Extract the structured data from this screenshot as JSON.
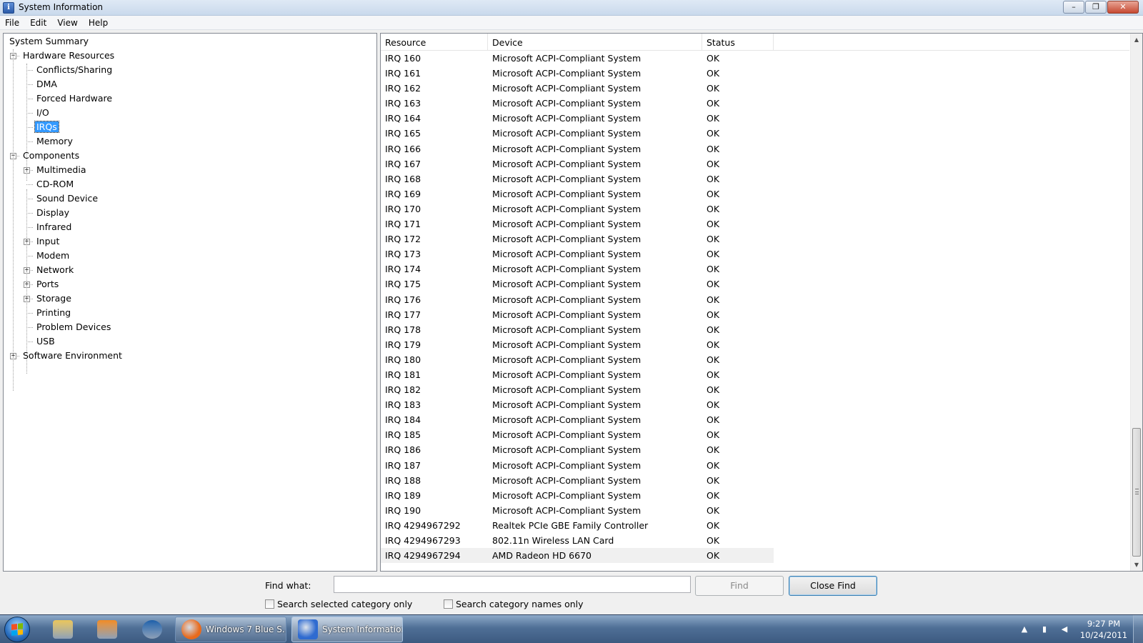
{
  "window": {
    "title": "System Information",
    "controls": {
      "minimize": "–",
      "maximize": "❐",
      "close": "✕"
    }
  },
  "menu": [
    "File",
    "Edit",
    "View",
    "Help"
  ],
  "tree": {
    "items": [
      {
        "label": "System Summary",
        "level": 0,
        "expander": "",
        "selected": false
      },
      {
        "label": "Hardware Resources",
        "level": 1,
        "expander": "−",
        "selected": false
      },
      {
        "label": "Conflicts/Sharing",
        "level": 2,
        "expander": "",
        "selected": false
      },
      {
        "label": "DMA",
        "level": 2,
        "expander": "",
        "selected": false
      },
      {
        "label": "Forced Hardware",
        "level": 2,
        "expander": "",
        "selected": false
      },
      {
        "label": "I/O",
        "level": 2,
        "expander": "",
        "selected": false
      },
      {
        "label": "IRQs",
        "level": 2,
        "expander": "",
        "selected": true
      },
      {
        "label": "Memory",
        "level": 2,
        "expander": "",
        "selected": false
      },
      {
        "label": "Components",
        "level": 1,
        "expander": "−",
        "selected": false
      },
      {
        "label": "Multimedia",
        "level": 2,
        "expander": "+",
        "selected": false
      },
      {
        "label": "CD-ROM",
        "level": 2,
        "expander": "",
        "selected": false
      },
      {
        "label": "Sound Device",
        "level": 2,
        "expander": "",
        "selected": false
      },
      {
        "label": "Display",
        "level": 2,
        "expander": "",
        "selected": false
      },
      {
        "label": "Infrared",
        "level": 2,
        "expander": "",
        "selected": false
      },
      {
        "label": "Input",
        "level": 2,
        "expander": "+",
        "selected": false
      },
      {
        "label": "Modem",
        "level": 2,
        "expander": "",
        "selected": false
      },
      {
        "label": "Network",
        "level": 2,
        "expander": "+",
        "selected": false
      },
      {
        "label": "Ports",
        "level": 2,
        "expander": "+",
        "selected": false
      },
      {
        "label": "Storage",
        "level": 2,
        "expander": "+",
        "selected": false
      },
      {
        "label": "Printing",
        "level": 2,
        "expander": "",
        "selected": false
      },
      {
        "label": "Problem Devices",
        "level": 2,
        "expander": "",
        "selected": false
      },
      {
        "label": "USB",
        "level": 2,
        "expander": "",
        "selected": false
      },
      {
        "label": "Software Environment",
        "level": 1,
        "expander": "+",
        "selected": false
      }
    ]
  },
  "list": {
    "columns": [
      "Resource",
      "Device",
      "Status"
    ],
    "rows": [
      [
        "IRQ 160",
        "Microsoft ACPI-Compliant System",
        "OK"
      ],
      [
        "IRQ 161",
        "Microsoft ACPI-Compliant System",
        "OK"
      ],
      [
        "IRQ 162",
        "Microsoft ACPI-Compliant System",
        "OK"
      ],
      [
        "IRQ 163",
        "Microsoft ACPI-Compliant System",
        "OK"
      ],
      [
        "IRQ 164",
        "Microsoft ACPI-Compliant System",
        "OK"
      ],
      [
        "IRQ 165",
        "Microsoft ACPI-Compliant System",
        "OK"
      ],
      [
        "IRQ 166",
        "Microsoft ACPI-Compliant System",
        "OK"
      ],
      [
        "IRQ 167",
        "Microsoft ACPI-Compliant System",
        "OK"
      ],
      [
        "IRQ 168",
        "Microsoft ACPI-Compliant System",
        "OK"
      ],
      [
        "IRQ 169",
        "Microsoft ACPI-Compliant System",
        "OK"
      ],
      [
        "IRQ 170",
        "Microsoft ACPI-Compliant System",
        "OK"
      ],
      [
        "IRQ 171",
        "Microsoft ACPI-Compliant System",
        "OK"
      ],
      [
        "IRQ 172",
        "Microsoft ACPI-Compliant System",
        "OK"
      ],
      [
        "IRQ 173",
        "Microsoft ACPI-Compliant System",
        "OK"
      ],
      [
        "IRQ 174",
        "Microsoft ACPI-Compliant System",
        "OK"
      ],
      [
        "IRQ 175",
        "Microsoft ACPI-Compliant System",
        "OK"
      ],
      [
        "IRQ 176",
        "Microsoft ACPI-Compliant System",
        "OK"
      ],
      [
        "IRQ 177",
        "Microsoft ACPI-Compliant System",
        "OK"
      ],
      [
        "IRQ 178",
        "Microsoft ACPI-Compliant System",
        "OK"
      ],
      [
        "IRQ 179",
        "Microsoft ACPI-Compliant System",
        "OK"
      ],
      [
        "IRQ 180",
        "Microsoft ACPI-Compliant System",
        "OK"
      ],
      [
        "IRQ 181",
        "Microsoft ACPI-Compliant System",
        "OK"
      ],
      [
        "IRQ 182",
        "Microsoft ACPI-Compliant System",
        "OK"
      ],
      [
        "IRQ 183",
        "Microsoft ACPI-Compliant System",
        "OK"
      ],
      [
        "IRQ 184",
        "Microsoft ACPI-Compliant System",
        "OK"
      ],
      [
        "IRQ 185",
        "Microsoft ACPI-Compliant System",
        "OK"
      ],
      [
        "IRQ 186",
        "Microsoft ACPI-Compliant System",
        "OK"
      ],
      [
        "IRQ 187",
        "Microsoft ACPI-Compliant System",
        "OK"
      ],
      [
        "IRQ 188",
        "Microsoft ACPI-Compliant System",
        "OK"
      ],
      [
        "IRQ 189",
        "Microsoft ACPI-Compliant System",
        "OK"
      ],
      [
        "IRQ 190",
        "Microsoft ACPI-Compliant System",
        "OK"
      ],
      [
        "IRQ 4294967292",
        "Realtek PCIe GBE Family Controller",
        "OK"
      ],
      [
        "IRQ 4294967293",
        "802.11n Wireless LAN Card",
        "OK"
      ],
      [
        "IRQ 4294967294",
        "AMD Radeon HD 6670",
        "OK"
      ]
    ],
    "scroll": {
      "up_arrow": "▲",
      "down_arrow": "▼"
    }
  },
  "find": {
    "label": "Find what:",
    "value": "",
    "placeholder": "",
    "find_button": "Find",
    "close_button": "Close Find",
    "checkbox_selected_category": "Search selected category only",
    "checkbox_category_names": "Search category names only"
  },
  "taskbar": {
    "pinned": [
      {
        "name": "explorer-icon",
        "color": "#e8c45a"
      },
      {
        "name": "media-player-icon",
        "color": "#f08a24"
      },
      {
        "name": "hp-icon",
        "color": "#1c5ea8"
      }
    ],
    "tasks": [
      {
        "label": "Windows 7 Blue S...",
        "icon": "firefox-icon",
        "color": "#e86a1c",
        "active": false
      },
      {
        "label": "System Information",
        "icon": "system-info-icon",
        "color": "#2f6bd0",
        "active": true
      }
    ],
    "tray": {
      "arrow": "▲",
      "network": "▮",
      "volume": "◀"
    },
    "time": "9:27 PM",
    "date": "10/24/2011"
  },
  "colors": {
    "selection": "#3399ff",
    "taskbar": "#4f6f96"
  }
}
